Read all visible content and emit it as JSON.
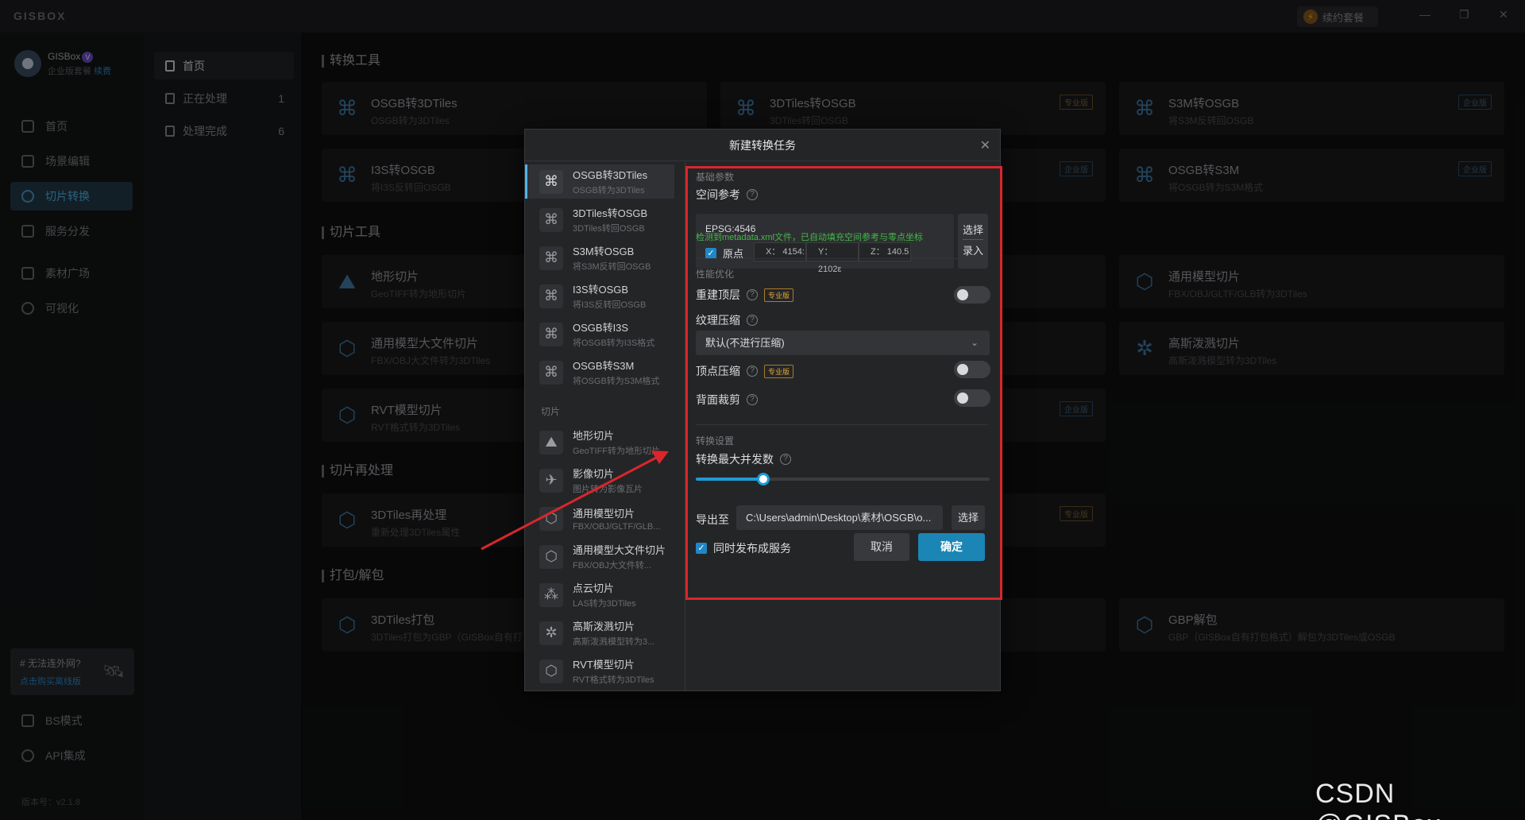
{
  "app": {
    "brand": "GISBOX",
    "renew": "续约套餐",
    "version": "版本号：v2.1.8"
  },
  "user": {
    "name": "GISBox",
    "plan": "企业版套餐",
    "renew_link": "续费"
  },
  "nav": {
    "items": [
      {
        "label": "首页"
      },
      {
        "label": "场景编辑"
      },
      {
        "label": "切片转换"
      },
      {
        "label": "服务分发"
      },
      {
        "label": "素材广场"
      },
      {
        "label": "可视化"
      }
    ],
    "bottom": [
      {
        "label": "BS模式"
      },
      {
        "label": "API集成"
      }
    ],
    "promo": {
      "title": "# 无法连外网?",
      "link": "点击购买离线版"
    }
  },
  "tasks": [
    {
      "label": "首页",
      "count": ""
    },
    {
      "label": "正在处理",
      "count": "1"
    },
    {
      "label": "处理完成",
      "count": "6"
    }
  ],
  "main": {
    "sections": [
      "转换工具",
      "切片工具",
      "切片再处理",
      "打包/解包"
    ],
    "cards": [
      {
        "title": "OSGB转3DTiles",
        "sub": "OSGB转为3DTiles",
        "badge": ""
      },
      {
        "title": "3DTiles转OSGB",
        "sub": "3DTiles转回OSGB",
        "badge": "专业版"
      },
      {
        "title": "S3M转OSGB",
        "sub": "将S3M反转回OSGB",
        "badge": "企业版"
      },
      {
        "title": "I3S转OSGB",
        "sub": "将I3S反转回OSGB",
        "badge": ""
      },
      {
        "title": "",
        "sub": "",
        "badge": "企业版"
      },
      {
        "title": "OSGB转S3M",
        "sub": "将OSGB转为S3M格式",
        "badge": "企业版"
      },
      {
        "title": "地形切片",
        "sub": "GeoTIFF转为地形切片",
        "badge": ""
      },
      {
        "title": "通用模型切片",
        "sub": "FBX/OBJ/GLTF/GLB转为3DTiles",
        "badge": ""
      },
      {
        "title": "通用模型大文件切片",
        "sub": "FBX/OBJ大文件转为3DTiles",
        "badge": ""
      },
      {
        "title": "高斯泼溅切片",
        "sub": "高斯泼溅模型转为3DTiles",
        "badge": ""
      },
      {
        "title": "RVT模型切片",
        "sub": "RVT格式转为3DTiles",
        "badge": ""
      },
      {
        "title": "",
        "sub": "",
        "badge": "企业版"
      },
      {
        "title": "3DTiles再处理",
        "sub": "重新处理3DTiles属性",
        "badge": ""
      },
      {
        "title": "",
        "sub": "",
        "badge": "专业版"
      },
      {
        "title": "3DTiles打包",
        "sub": "3DTiles打包为GBP（GISBox自有打",
        "badge": ""
      },
      {
        "title": "GBP解包",
        "sub": "GBP（GISBox自有打包格式）解包为3DTiles或OSGB",
        "badge": ""
      }
    ]
  },
  "dialog": {
    "title": "新建转换任务",
    "list": [
      {
        "title": "OSGB转3DTiles",
        "sub": "OSGB转为3DTiles"
      },
      {
        "title": "3DTiles转OSGB",
        "sub": "3DTiles转回OSGB"
      },
      {
        "title": "S3M转OSGB",
        "sub": "将S3M反转回OSGB"
      },
      {
        "title": "I3S转OSGB",
        "sub": "将I3S反转回OSGB"
      },
      {
        "title": "OSGB转I3S",
        "sub": "将OSGB转为I3S格式"
      },
      {
        "title": "OSGB转S3M",
        "sub": "将OSGB转为S3M格式"
      },
      {
        "title": "地形切片",
        "sub": "GeoTIFF转为地形切片"
      },
      {
        "title": "影像切片",
        "sub": "图片转为影像瓦片"
      },
      {
        "title": "通用模型切片",
        "sub": "FBX/OBJ/GLTF/GLB..."
      },
      {
        "title": "通用模型大文件切片",
        "sub": "FBX/OBJ大文件转..."
      },
      {
        "title": "点云切片",
        "sub": "LAS转为3DTiles"
      },
      {
        "title": "高斯泼溅切片",
        "sub": "高斯泼溅模型转为3..."
      },
      {
        "title": "RVT模型切片",
        "sub": "RVT格式转为3DTiles"
      }
    ],
    "group_label": "切片",
    "form": {
      "basic_label": "基础参数",
      "crs_label": "空间参考",
      "crs_value": "EPSG:4546",
      "origin_label": "原点",
      "x": "X： 4154:",
      "y": "Y： 2102ε",
      "z": "Z： 140.5",
      "select_btn": "选择",
      "input_btn": "录入",
      "hint": "检测到metadata.xml文件，已自动填充空间参考与零点坐标",
      "perf_label": "性能优化",
      "rebuild_top": "重建顶层",
      "pro_badge": "专业版",
      "texture_label": "纹理压缩",
      "texture_value": "默认(不进行压缩)",
      "vertex_label": "顶点压缩",
      "backface_label": "背面裁剪",
      "convert_label": "转换设置",
      "concurrency_label": "转换最大并发数",
      "concurrency_fraction": 0.23,
      "export_label": "导出至",
      "export_path": "C:\\Users\\admin\\Desktop\\素材\\OSGB\\o...",
      "export_select": "选择",
      "publish_label": "同时发布成服务",
      "cancel": "取消",
      "confirm": "确定"
    }
  },
  "watermark": "CSDN @GISBox",
  "colors": {
    "accent": "#1e9bd7",
    "annotation": "#d9262c",
    "hint": "#44b94a",
    "pro": "#e0a83b"
  }
}
